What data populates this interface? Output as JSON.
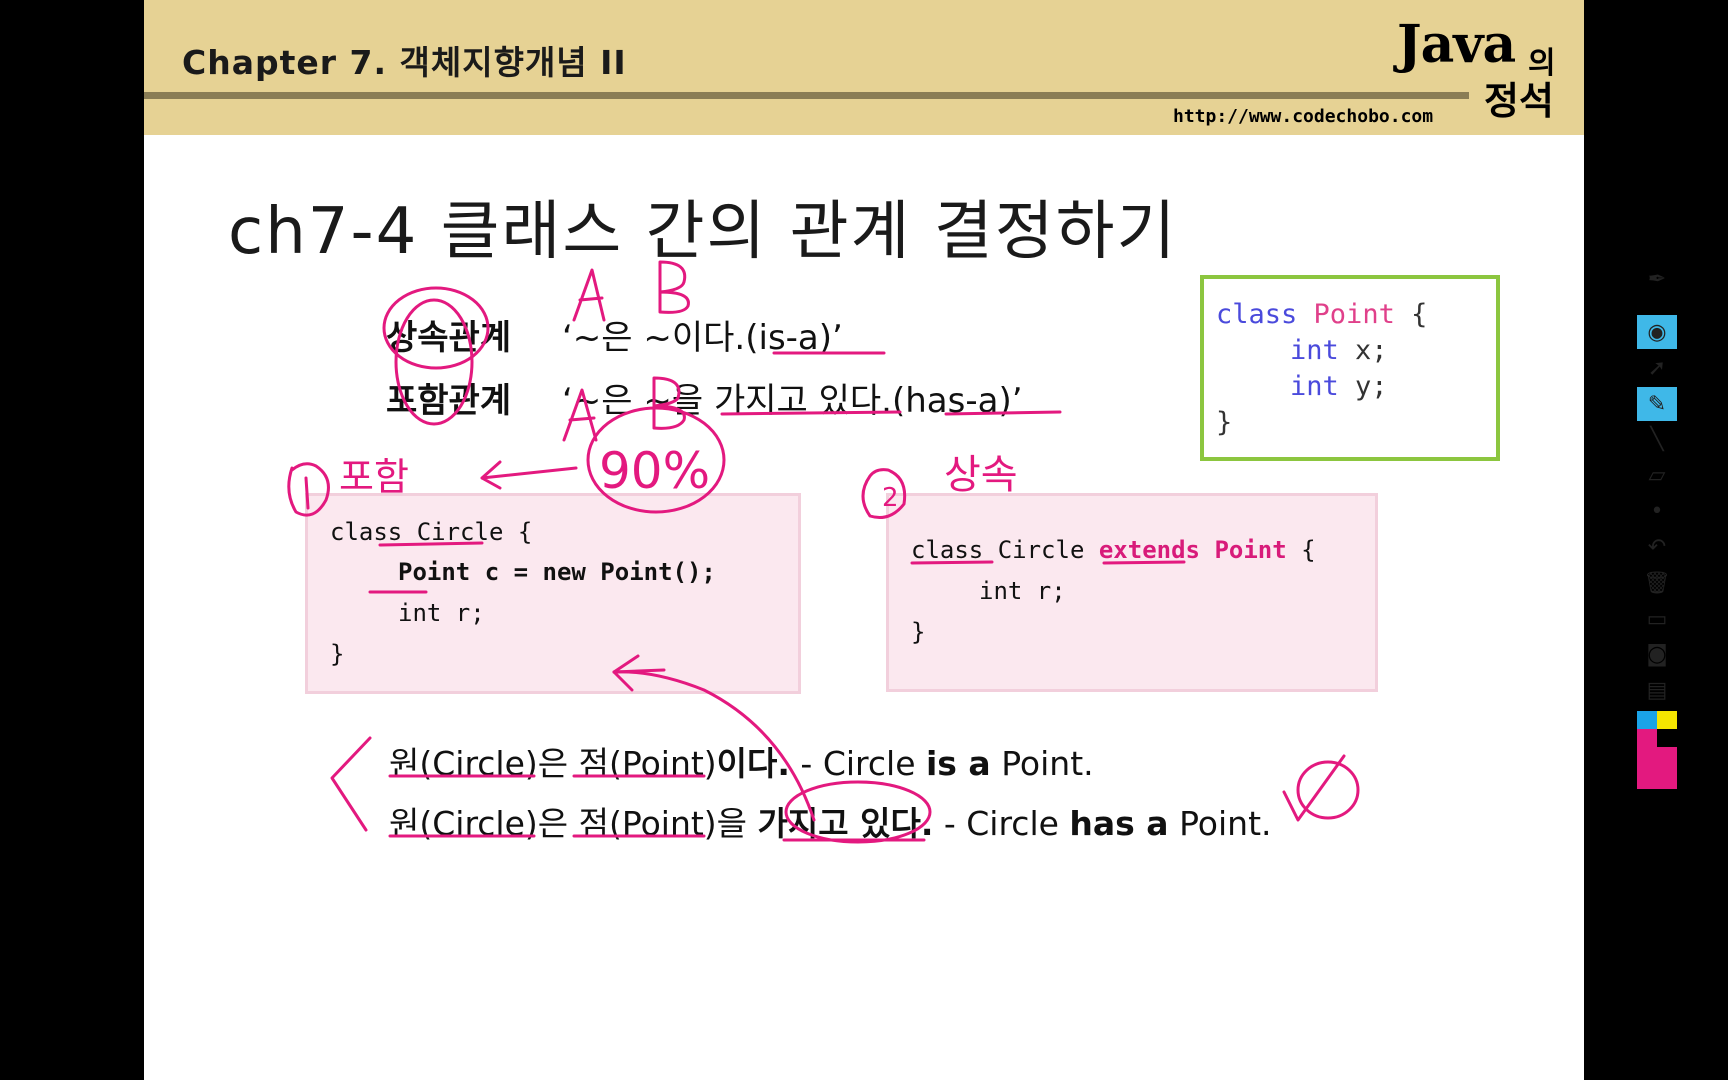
{
  "header": {
    "chapter_title": "Chapter 7. 객체지향개념 II",
    "logo_java": "Java",
    "logo_ui": "의",
    "logo_jeongseok": "정석",
    "url": "http://www.codechobo.com"
  },
  "slide": {
    "title": "ch7-4 클래스 간의 관계 결정하기",
    "relations": [
      {
        "label": "상속관계",
        "desc": "‘~은 ~이다.(is-a)’"
      },
      {
        "label": "포함관계",
        "desc": "‘~은 ~을 가지고 있다.(has-a)’"
      }
    ],
    "point_class": {
      "line1_kw": "class",
      "line1_name": "Point",
      "line1_brace": "{",
      "line2_kw": "int",
      "line2_rest": "x;",
      "line3_kw": "int",
      "line3_rest": "y;",
      "line4": "}"
    },
    "composition_code": {
      "line1": "class Circle {",
      "line2": "Point c = new Point();",
      "line3": "int r;",
      "line4": "}"
    },
    "inheritance_code": {
      "line1_a": "class Circle ",
      "line1_ext": "extends Point",
      "line1_b": " {",
      "line2": "int r;",
      "line3": "}"
    },
    "statements": [
      {
        "ko": "원(Circle)은 점(Point)",
        "ko_bold": "이다.",
        "en_pre": " - Circle ",
        "en_bold": "is a",
        "en_post": " Point."
      },
      {
        "ko": "원(Circle)은 점(Point)을 ",
        "ko_bold": "가지고 있다.",
        "en_pre": " - Circle ",
        "en_bold": "has a",
        "en_post": " Point."
      }
    ]
  },
  "annotations": {
    "ink_color": "#e3197f",
    "handwriting": [
      "A",
      "B",
      "A",
      "B",
      "① 포함",
      "90%",
      "② 상속"
    ]
  },
  "toolbar": {
    "tools": [
      "pen-icon",
      "eye-icon",
      "pointer-icon",
      "highlighter-icon",
      "line-icon",
      "eraser-icon",
      "dot-icon",
      "undo-icon",
      "trash-icon",
      "whiteboard-icon",
      "camera-icon",
      "clipboard-icon",
      "color-palette"
    ],
    "palette_colors": [
      "#1aa3e8",
      "#f5e600",
      "#e3197f",
      "#000000"
    ]
  }
}
